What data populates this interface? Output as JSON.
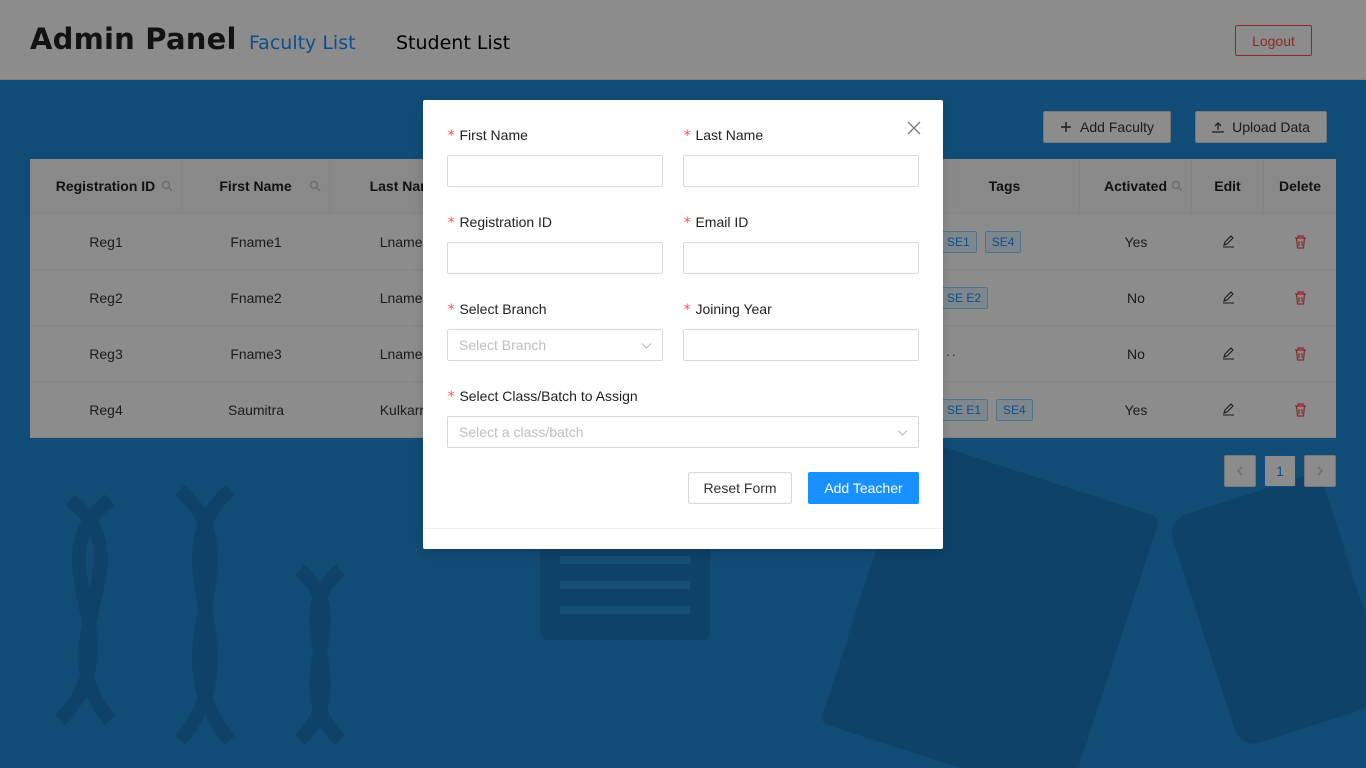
{
  "header": {
    "title": "Admin Panel",
    "nav": [
      {
        "label": "Faculty List",
        "active": true
      },
      {
        "label": "Student List",
        "active": false
      }
    ],
    "logout_label": "Logout"
  },
  "actions": {
    "add_faculty_label": "Add Faculty",
    "upload_label": "Upload Data"
  },
  "table": {
    "columns": {
      "reg_id": "Registration ID",
      "first_name": "First Name",
      "last_name": "Last Name",
      "tags": "Tags",
      "activated": "Activated",
      "edit": "Edit",
      "delete": "Delete"
    },
    "rows": [
      {
        "reg_id": "Reg1",
        "first_name": "Fname1",
        "last_name": "Lname1",
        "tags": [
          "SE1",
          "SE4"
        ],
        "activated": "Yes"
      },
      {
        "reg_id": "Reg2",
        "first_name": "Fname2",
        "last_name": "Lname2",
        "tags": [
          "SE E2"
        ],
        "activated": "No"
      },
      {
        "reg_id": "Reg3",
        "first_name": "Fname3",
        "last_name": "Lname3",
        "tags": [
          "···"
        ],
        "activated": "No"
      },
      {
        "reg_id": "Reg4",
        "first_name": "Saumitra",
        "last_name": "Kulkarni",
        "tags": [
          "SE E1",
          "SE4"
        ],
        "activated": "Yes"
      }
    ]
  },
  "pagination": {
    "current_page": "1",
    "prev_icon": "chevron-left-icon",
    "next_icon": "chevron-right-icon"
  },
  "modal": {
    "required_mark": "*",
    "fields": {
      "first_name": {
        "label": "First Name",
        "value": ""
      },
      "last_name": {
        "label": "Last Name",
        "value": ""
      },
      "registration_id": {
        "label": "Registration ID",
        "value": ""
      },
      "email_id": {
        "label": "Email ID",
        "value": ""
      },
      "branch": {
        "label": "Select Branch",
        "placeholder": "Select Branch"
      },
      "joining_year": {
        "label": "Joining Year",
        "value": ""
      },
      "class_batch": {
        "label": "Select Class/Batch to Assign",
        "placeholder": "Select a class/batch"
      }
    },
    "reset_label": "Reset Form",
    "submit_label": "Add Teacher"
  },
  "colors": {
    "primary": "#1890ff",
    "danger": "#ff4d4f",
    "background": "#1e8ad6"
  }
}
